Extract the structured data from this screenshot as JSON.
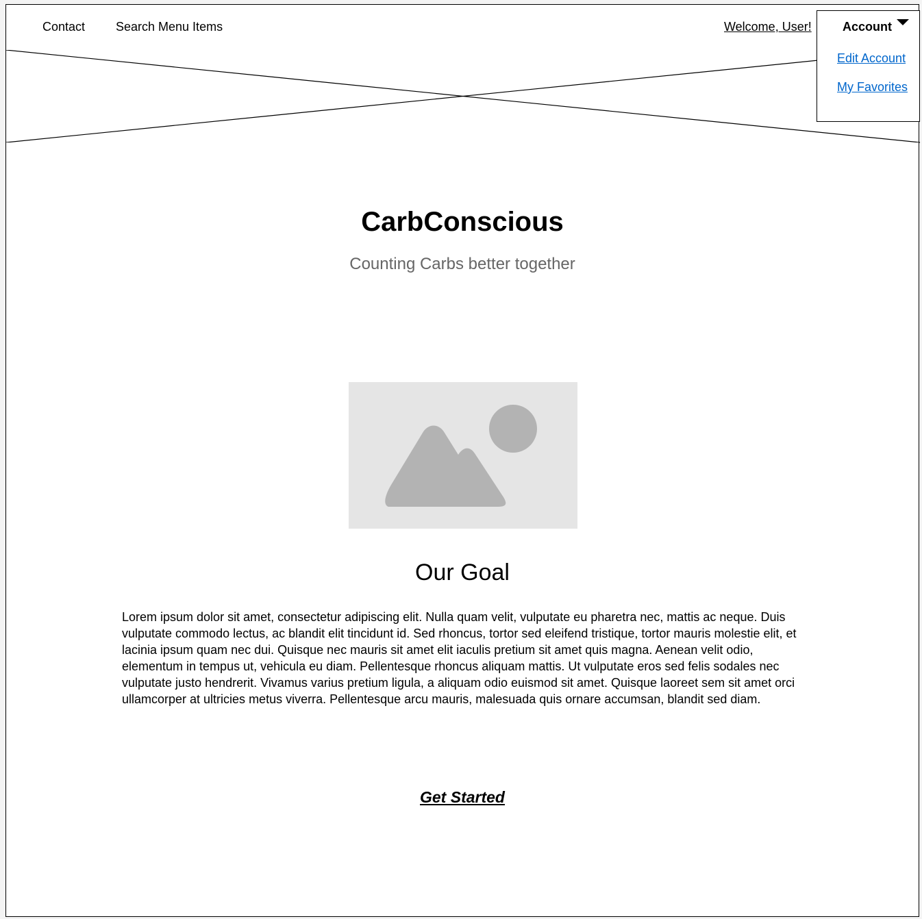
{
  "nav": {
    "links": [
      {
        "label": "Contact"
      },
      {
        "label": "Search Menu Items"
      }
    ],
    "welcome": "Welcome, User!"
  },
  "account_menu": {
    "label": "Account",
    "caret_icon": "caret-down-icon",
    "items": [
      {
        "label": "Edit Account"
      },
      {
        "label": "My Favorites"
      }
    ]
  },
  "hero": {
    "title": "CarbConscious",
    "subtitle": "Counting Carbs better together"
  },
  "goal": {
    "image_icon": "image-placeholder-icon",
    "heading": "Our Goal",
    "body": "Lorem ipsum dolor sit amet, consectetur adipiscing elit. Nulla quam velit, vulputate eu pharetra nec, mattis ac neque. Duis vulputate commodo lectus, ac blandit elit tincidunt id. Sed rhoncus, tortor sed eleifend tristique, tortor mauris molestie elit, et lacinia ipsum quam nec dui. Quisque nec mauris sit amet elit iaculis pretium sit amet quis magna. Aenean velit odio, elementum in tempus ut, vehicula eu diam. Pellentesque rhoncus aliquam mattis. Ut vulputate eros sed felis sodales nec vulputate justo hendrerit. Vivamus varius pretium ligula, a aliquam odio euismod sit amet. Quisque laoreet sem sit amet orci ullamcorper at ultricies metus viverra. Pellentesque arcu mauris, malesuada quis ornare accumsan, blandit sed diam.",
    "cta": "Get Started"
  },
  "colors": {
    "link": "#0066cc",
    "subtitle": "#666666",
    "placeholder_bg": "#e5e5e5",
    "placeholder_shape": "#b3b3b3"
  }
}
